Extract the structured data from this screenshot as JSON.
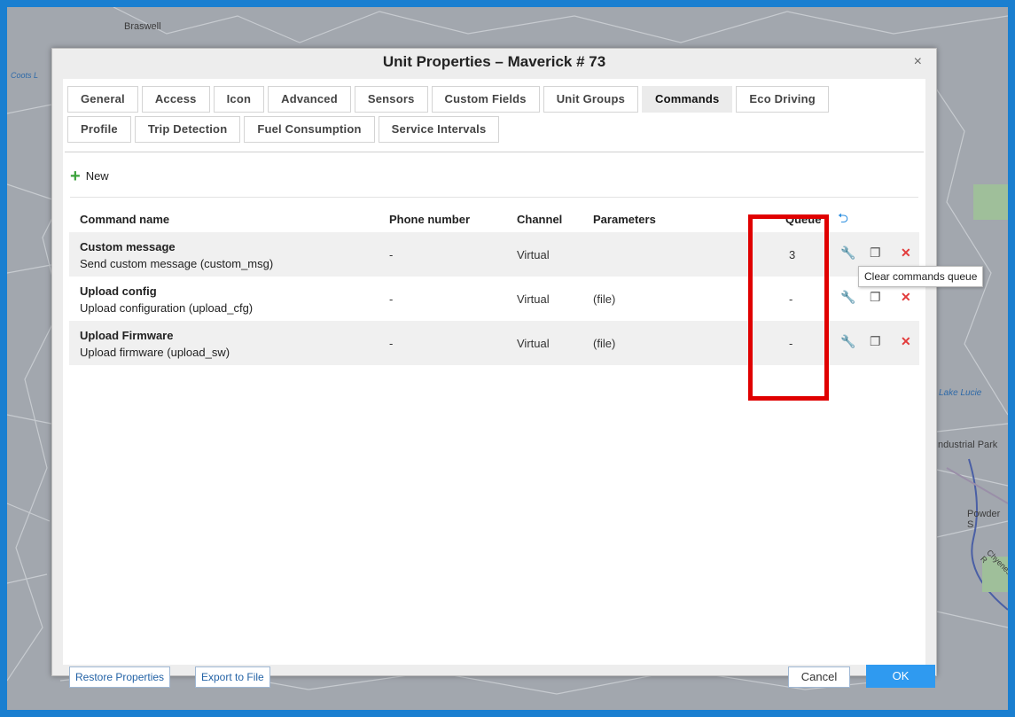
{
  "map": {
    "labels": [
      "Braswell",
      "Coots L",
      "Lake Lucie",
      "Industrial Park",
      "Powder S",
      "Chyenes R"
    ]
  },
  "dialog": {
    "title": "Unit Properties – Maverick # 73",
    "close": "×"
  },
  "tabs_row1": [
    "General",
    "Access",
    "Icon",
    "Advanced",
    "Sensors",
    "Custom Fields",
    "Unit Groups",
    "Commands",
    "Eco Driving"
  ],
  "tabs_row2": [
    "Profile",
    "Trip Detection",
    "Fuel Consumption",
    "Service Intervals"
  ],
  "active_tab": "Commands",
  "new_button": {
    "icon": "+",
    "label": "New"
  },
  "table": {
    "headers": {
      "name": "Command name",
      "phone": "Phone number",
      "channel": "Channel",
      "params": "Parameters",
      "queue": "Queue"
    },
    "rows": [
      {
        "name": "Custom message",
        "desc": "Send custom message (custom_msg)",
        "phone": "-",
        "channel": "Virtual",
        "params": "",
        "queue": "3"
      },
      {
        "name": "Upload config",
        "desc": "Upload configuration (upload_cfg)",
        "phone": "-",
        "channel": "Virtual",
        "params": "(file)",
        "queue": "-"
      },
      {
        "name": "Upload Firmware",
        "desc": "Upload firmware (upload_sw)",
        "phone": "-",
        "channel": "Virtual",
        "params": "(file)",
        "queue": "-"
      }
    ]
  },
  "icons": {
    "undo": "⮌",
    "edit": "🔧",
    "copy": "❐",
    "delete": "✕"
  },
  "tooltip": "Clear commands queue",
  "footer": {
    "restore": "Restore Properties",
    "export": "Export to File",
    "cancel": "Cancel",
    "ok": "OK"
  },
  "colors": {
    "accent": "#2f9af0",
    "highlight": "#e00000",
    "delete": "#e23b3b",
    "add": "#3aa23a"
  }
}
